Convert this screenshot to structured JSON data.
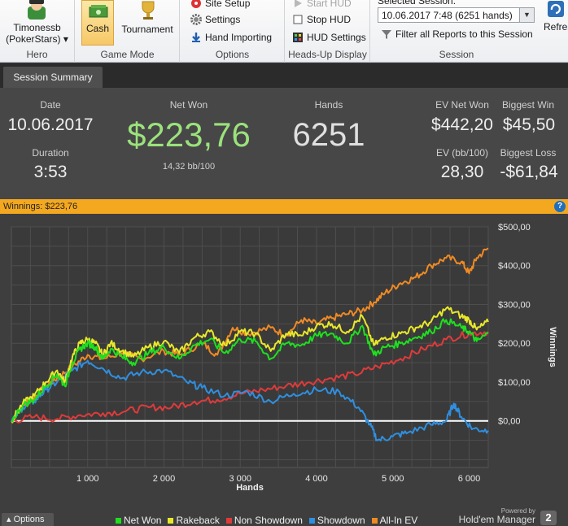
{
  "ribbon": {
    "hero": {
      "name": "Timonessb",
      "site": "(PokerStars)",
      "group_label": "Hero"
    },
    "game_mode": {
      "cash_label": "Cash",
      "tournament_label": "Tournament",
      "group_label": "Game Mode",
      "selected": "Cash"
    },
    "options": {
      "site_setup": "Site Setup",
      "settings": "Settings",
      "hand_importing": "Hand Importing",
      "group_label": "Options"
    },
    "hud": {
      "start_hud": "Start HUD",
      "stop_hud": "Stop HUD",
      "hud_settings": "HUD Settings",
      "group_label": "Heads-Up Display"
    },
    "session": {
      "label": "Selected Session:",
      "selected_value": "10.06.2017 7:48 (6251 hands)",
      "filter_label": "Filter all Reports to this Session",
      "group_label": "Session"
    },
    "refresh_label": "Refres"
  },
  "tabs": [
    {
      "label": "Session Summary"
    }
  ],
  "summary": {
    "date": {
      "label": "Date",
      "value": "10.06.2017"
    },
    "duration": {
      "label": "Duration",
      "value": "3:53"
    },
    "net_won": {
      "label": "Net Won",
      "value": "$223,76",
      "sub": "14,32 bb/100"
    },
    "hands": {
      "label": "Hands",
      "value": "6251"
    },
    "ev_net_won": {
      "label": "EV Net Won",
      "value": "$442,20"
    },
    "ev_bb100": {
      "label": "EV (bb/100)",
      "value": "28,30"
    },
    "biggest_win": {
      "label": "Biggest Win",
      "value": "$45,50"
    },
    "biggest_loss": {
      "label": "Biggest Loss",
      "value": "-$61,84"
    }
  },
  "winnings_bar": {
    "text": "Winnings: $223,76"
  },
  "bottom": {
    "options_label": "Options",
    "powered_by": "Powered by",
    "brand": "Hold'em Manager",
    "brand_version": "2"
  },
  "colors": {
    "net_won": "#1ee01e",
    "rakeback": "#e8e82a",
    "non_showdown": "#e03a3a",
    "showdown": "#2f8fe0",
    "all_in_ev": "#f08a24",
    "zero_line": "#ffffff"
  },
  "chart_data": {
    "type": "line",
    "xlabel": "Hands",
    "ylabel": "Winnings",
    "xlim": [
      0,
      6251
    ],
    "ylim": [
      -120,
      500
    ],
    "x_ticks": [
      1000,
      2000,
      3000,
      4000,
      5000,
      6000
    ],
    "x_tick_labels": [
      "1 000",
      "2 000",
      "3 000",
      "4 000",
      "5 000",
      "6 000"
    ],
    "y_ticks": [
      0,
      100,
      200,
      300,
      400,
      500
    ],
    "y_tick_labels": [
      "$0,00",
      "$100,00",
      "$200,00",
      "$300,00",
      "$400,00",
      "$500,00"
    ],
    "grid": true,
    "legend_position": "bottom",
    "series": [
      {
        "name": "Net Won",
        "color": "#1ee01e",
        "x": [
          0,
          150,
          300,
          450,
          600,
          700,
          800,
          900,
          1000,
          1100,
          1200,
          1300,
          1450,
          1600,
          1800,
          2000,
          2200,
          2400,
          2600,
          2800,
          3000,
          3200,
          3400,
          3600,
          3800,
          4000,
          4200,
          4400,
          4600,
          4750,
          4900,
          5100,
          5300,
          5500,
          5700,
          5900,
          6000,
          6100,
          6251
        ],
        "y": [
          0,
          40,
          55,
          90,
          120,
          90,
          150,
          185,
          200,
          190,
          160,
          185,
          165,
          150,
          175,
          190,
          160,
          195,
          210,
          175,
          210,
          205,
          160,
          200,
          195,
          220,
          225,
          200,
          245,
          170,
          190,
          200,
          215,
          230,
          260,
          240,
          230,
          205,
          225
        ]
      },
      {
        "name": "Rakeback",
        "color": "#e8e82a",
        "x": [
          0,
          150,
          300,
          450,
          600,
          700,
          800,
          900,
          1000,
          1100,
          1200,
          1300,
          1450,
          1600,
          1800,
          2000,
          2200,
          2400,
          2600,
          2800,
          3000,
          3200,
          3400,
          3600,
          3800,
          4000,
          4200,
          4400,
          4600,
          4750,
          4900,
          5100,
          5300,
          5500,
          5700,
          5900,
          6000,
          6100,
          6251
        ],
        "y": [
          0,
          45,
          65,
          100,
          130,
          100,
          165,
          200,
          210,
          200,
          170,
          200,
          180,
          165,
          190,
          205,
          175,
          215,
          230,
          195,
          230,
          225,
          180,
          225,
          220,
          245,
          250,
          230,
          270,
          195,
          215,
          225,
          240,
          255,
          290,
          270,
          260,
          235,
          255
        ]
      },
      {
        "name": "Non Showdown",
        "color": "#e03a3a",
        "x": [
          0,
          300,
          600,
          900,
          1200,
          1500,
          1800,
          2100,
          2400,
          2700,
          3000,
          3300,
          3600,
          3900,
          4200,
          4500,
          4800,
          5100,
          5400,
          5700,
          6000,
          6251
        ],
        "y": [
          0,
          10,
          5,
          15,
          20,
          25,
          35,
          35,
          50,
          55,
          70,
          80,
          90,
          100,
          110,
          120,
          140,
          160,
          185,
          210,
          225,
          230
        ]
      },
      {
        "name": "Showdown",
        "color": "#2f8fe0",
        "x": [
          0,
          150,
          300,
          450,
          600,
          800,
          1000,
          1200,
          1450,
          1700,
          2000,
          2300,
          2500,
          2800,
          3100,
          3400,
          3700,
          4000,
          4300,
          4550,
          4700,
          4800,
          5000,
          5200,
          5500,
          5700,
          5800,
          5900,
          6050,
          6251
        ],
        "y": [
          0,
          35,
          50,
          80,
          100,
          130,
          155,
          135,
          110,
          125,
          130,
          100,
          85,
          65,
          75,
          50,
          70,
          80,
          75,
          35,
          -10,
          -50,
          -40,
          -30,
          -10,
          0,
          45,
          10,
          -20,
          -25
        ]
      },
      {
        "name": "All-In EV",
        "color": "#f08a24",
        "x": [
          0,
          150,
          300,
          450,
          600,
          800,
          1000,
          1200,
          1450,
          1700,
          2000,
          2200,
          2500,
          2700,
          2900,
          3100,
          3400,
          3600,
          3800,
          4000,
          4200,
          4400,
          4600,
          4750,
          4900,
          5100,
          5300,
          5500,
          5700,
          5900,
          6000,
          6100,
          6251
        ],
        "y": [
          0,
          40,
          60,
          90,
          110,
          140,
          170,
          160,
          175,
          160,
          180,
          170,
          200,
          170,
          240,
          225,
          240,
          220,
          260,
          250,
          265,
          275,
          285,
          305,
          330,
          355,
          370,
          400,
          420,
          410,
          380,
          420,
          445
        ]
      }
    ]
  }
}
